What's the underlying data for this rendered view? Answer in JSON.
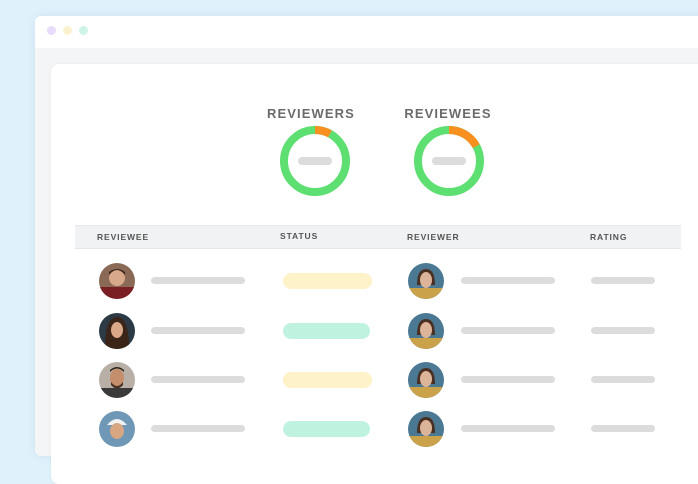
{
  "window": {
    "controls": [
      "close-dot",
      "minimize-dot",
      "maximize-dot"
    ]
  },
  "stats": {
    "reviewers": {
      "title": "REVIEWERS",
      "completed_fraction": 0.92
    },
    "reviewees": {
      "title": "REVIEWEES",
      "completed_fraction": 0.83
    }
  },
  "colors": {
    "complete": "#5ddf71",
    "pending": "#f7901e",
    "status_pending": "#fdf2c8",
    "status_done": "#bff3df",
    "placeholder": "#dcdcdc"
  },
  "table": {
    "columns": {
      "reviewee": "REVIEWEE",
      "status": "STATUS",
      "reviewer": "REVIEWER",
      "rating": "RATING"
    },
    "rows": [
      {
        "reviewee_avatar": "person-avatar",
        "status": "pending",
        "reviewer_avatar": "person-avatar"
      },
      {
        "reviewee_avatar": "person-avatar",
        "status": "done",
        "reviewer_avatar": "person-avatar"
      },
      {
        "reviewee_avatar": "person-avatar",
        "status": "pending",
        "reviewer_avatar": "person-avatar"
      },
      {
        "reviewee_avatar": "person-avatar",
        "status": "done",
        "reviewer_avatar": "person-avatar"
      }
    ]
  }
}
